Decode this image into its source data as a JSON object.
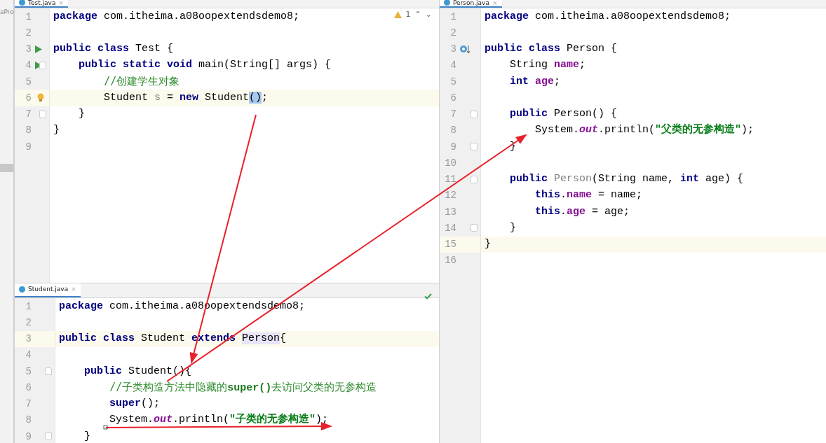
{
  "side_panel": {
    "label": "aPro"
  },
  "editors": [
    {
      "tab": {
        "label": "Test.java",
        "close": "×"
      },
      "status": {
        "kind": "warning",
        "count": "1",
        "up": "⌃",
        "down": "⌄"
      },
      "lines": [
        {
          "num": "1",
          "current": false,
          "tokens": [
            {
              "text": "package ",
              "kind": "kw"
            },
            {
              "text": "com.itheima.a08oopextendsdemo8;",
              "kind": "plain"
            }
          ]
        },
        {
          "num": "2",
          "current": false
        },
        {
          "num": "3",
          "current": false,
          "icon": {
            "kind": "run"
          },
          "tokens": [
            {
              "text": "public class ",
              "kind": "kw"
            },
            {
              "text": "Test {",
              "kind": "plain"
            }
          ]
        },
        {
          "num": "4",
          "current": false,
          "icon": {
            "kind": "run"
          },
          "fold": {
            "kind": "start"
          },
          "tokens": [
            {
              "text": "    public static void ",
              "kind": "kw"
            },
            {
              "text": "main(String[] args) {",
              "kind": "plain"
            }
          ]
        },
        {
          "num": "5",
          "current": false,
          "tokens": [
            {
              "text": "        //创建学生对象",
              "kind": "comment"
            }
          ]
        },
        {
          "num": "6",
          "current": true,
          "icon": {
            "kind": "bulb"
          },
          "tokens": [
            {
              "text": "        Student ",
              "kind": "plain"
            },
            {
              "text": "s",
              "kind": "unused"
            },
            {
              "text": " = ",
              "kind": "plain"
            },
            {
              "text": "new ",
              "kind": "kw"
            },
            {
              "text": "Student",
              "kind": "plain"
            },
            {
              "text": "()",
              "kind": "sel"
            },
            {
              "text": ";",
              "kind": "plain"
            }
          ]
        },
        {
          "num": "7",
          "current": false,
          "fold": {
            "kind": "end"
          },
          "tokens": [
            {
              "text": "    }",
              "kind": "plain"
            }
          ]
        },
        {
          "num": "8",
          "current": false,
          "tokens": [
            {
              "text": "}",
              "kind": "plain"
            }
          ]
        },
        {
          "num": "9",
          "current": false
        }
      ]
    },
    {
      "tab": {
        "label": "Student.java",
        "close": "×"
      },
      "status": {
        "kind": "ok"
      },
      "lines": [
        {
          "num": "1",
          "current": false,
          "tokens": [
            {
              "text": "package ",
              "kind": "kw"
            },
            {
              "text": "com.itheima.a08oopextendsdemo8;",
              "kind": "plain"
            }
          ]
        },
        {
          "num": "2",
          "current": false
        },
        {
          "num": "3",
          "current": true,
          "tokens": [
            {
              "text": "public class ",
              "kind": "kw"
            },
            {
              "text": "Student ",
              "kind": "plain"
            },
            {
              "text": "extends ",
              "kind": "kw"
            },
            {
              "text": "Person",
              "kind": "ref"
            },
            {
              "text": "{",
              "kind": "plain"
            }
          ]
        },
        {
          "num": "4",
          "current": false
        },
        {
          "num": "5",
          "current": false,
          "fold": {
            "kind": "start"
          },
          "tokens": [
            {
              "text": "    public ",
              "kind": "kw"
            },
            {
              "text": "Student(){",
              "kind": "plain"
            }
          ]
        },
        {
          "num": "6",
          "current": false,
          "tokens": [
            {
              "text": "        //子类构造方法中隐藏的",
              "kind": "comment"
            },
            {
              "text": "super()",
              "kind": "commentbold"
            },
            {
              "text": "去访问父类的无参构造",
              "kind": "comment"
            }
          ]
        },
        {
          "num": "7",
          "current": false,
          "tokens": [
            {
              "text": "        super",
              "kind": "kw"
            },
            {
              "text": "();",
              "kind": "plain"
            }
          ]
        },
        {
          "num": "8",
          "current": false,
          "tokens": [
            {
              "text": "        System.",
              "kind": "plain"
            },
            {
              "text": "out",
              "kind": "static"
            },
            {
              "text": ".println(",
              "kind": "plain"
            },
            {
              "text": "\"子类的无参构造\"",
              "kind": "string"
            },
            {
              "text": ");",
              "kind": "plain"
            }
          ]
        },
        {
          "num": "9",
          "current": false,
          "fold": {
            "kind": "end"
          },
          "tokens": [
            {
              "text": "    }",
              "kind": "plain"
            }
          ]
        }
      ]
    },
    {
      "tab": {
        "label": "Person.java",
        "close": "×"
      },
      "lines": [
        {
          "num": "1",
          "current": false,
          "tokens": [
            {
              "text": "package ",
              "kind": "kw"
            },
            {
              "text": "com.itheima.a08oopextendsdemo8;",
              "kind": "plain"
            }
          ]
        },
        {
          "num": "2",
          "current": false
        },
        {
          "num": "3",
          "current": false,
          "icon": {
            "kind": "override"
          },
          "tokens": [
            {
              "text": "public class ",
              "kind": "kw"
            },
            {
              "text": "Person {",
              "kind": "plain"
            }
          ]
        },
        {
          "num": "4",
          "current": false,
          "tokens": [
            {
              "text": "    String ",
              "kind": "plain"
            },
            {
              "text": "name",
              "kind": "field"
            },
            {
              "text": ";",
              "kind": "plain"
            }
          ]
        },
        {
          "num": "5",
          "current": false,
          "tokens": [
            {
              "text": "    int ",
              "kind": "kw"
            },
            {
              "text": "age",
              "kind": "field"
            },
            {
              "text": ";",
              "kind": "plain"
            }
          ]
        },
        {
          "num": "6",
          "current": false
        },
        {
          "num": "7",
          "current": false,
          "fold": {
            "kind": "start"
          },
          "tokens": [
            {
              "text": "    public ",
              "kind": "kw"
            },
            {
              "text": "Person() {",
              "kind": "plain"
            }
          ]
        },
        {
          "num": "8",
          "current": false,
          "tokens": [
            {
              "text": "        System.",
              "kind": "plain"
            },
            {
              "text": "out",
              "kind": "static"
            },
            {
              "text": ".println(",
              "kind": "plain"
            },
            {
              "text": "\"父类的无参构造\"",
              "kind": "string"
            },
            {
              "text": ");",
              "kind": "plain"
            }
          ]
        },
        {
          "num": "9",
          "current": false,
          "fold": {
            "kind": "end"
          },
          "tokens": [
            {
              "text": "    }",
              "kind": "plain"
            }
          ]
        },
        {
          "num": "10",
          "current": false
        },
        {
          "num": "11",
          "current": false,
          "fold": {
            "kind": "start"
          },
          "tokens": [
            {
              "text": "    public ",
              "kind": "kw"
            },
            {
              "text": "Person",
              "kind": "unused"
            },
            {
              "text": "(String name, ",
              "kind": "plain"
            },
            {
              "text": "int ",
              "kind": "kw"
            },
            {
              "text": "age) {",
              "kind": "plain"
            }
          ]
        },
        {
          "num": "12",
          "current": false,
          "tokens": [
            {
              "text": "        this",
              "kind": "kw"
            },
            {
              "text": ".",
              "kind": "plain"
            },
            {
              "text": "name",
              "kind": "field"
            },
            {
              "text": " = name;",
              "kind": "plain"
            }
          ]
        },
        {
          "num": "13",
          "current": false,
          "tokens": [
            {
              "text": "        this",
              "kind": "kw"
            },
            {
              "text": ".",
              "kind": "plain"
            },
            {
              "text": "age",
              "kind": "field"
            },
            {
              "text": " = age;",
              "kind": "plain"
            }
          ]
        },
        {
          "num": "14",
          "current": false,
          "fold": {
            "kind": "end"
          },
          "tokens": [
            {
              "text": "    }",
              "kind": "plain"
            }
          ]
        },
        {
          "num": "15",
          "current": true,
          "tokens": [
            {
              "text": "}",
              "kind": "plain"
            }
          ]
        },
        {
          "num": "16",
          "current": false
        }
      ]
    }
  ]
}
